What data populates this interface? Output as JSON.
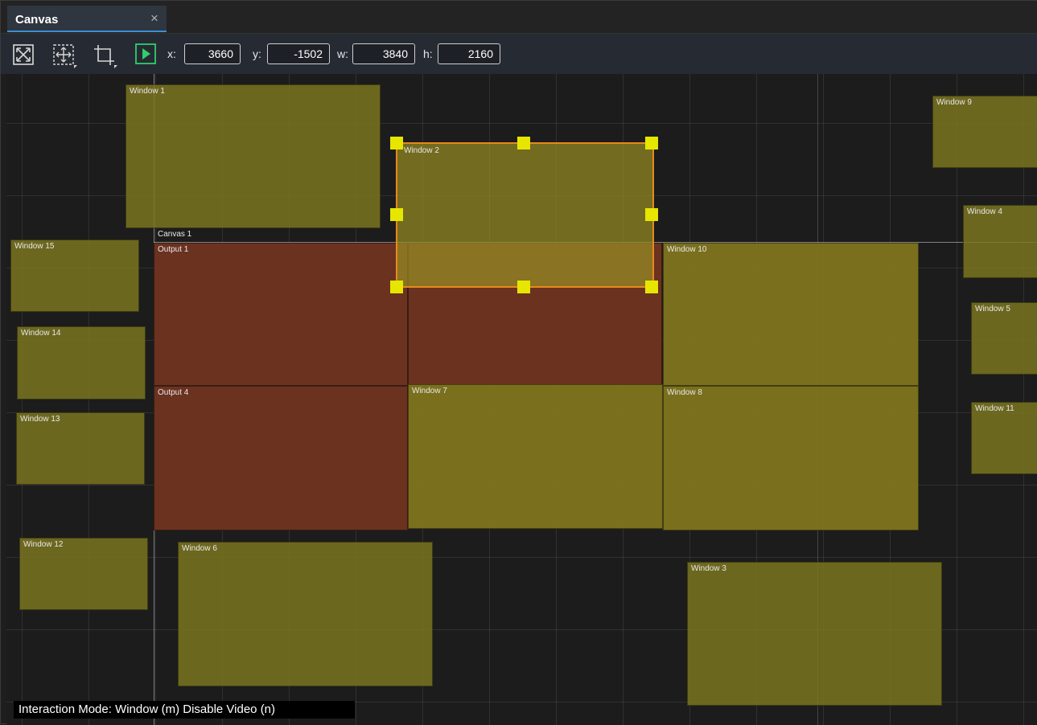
{
  "tab": {
    "title": "Canvas",
    "close_glyph": "×"
  },
  "toolbar": {
    "icons": [
      "fit-screen-icon",
      "move-pan-icon",
      "crop-icon",
      "play-icon"
    ],
    "x_label": "x:",
    "x_value": "3660",
    "y_label": "y:",
    "y_value": "-1502",
    "w_label": "w:",
    "w_value": "3840",
    "h_label": "h:",
    "h_value": "2160",
    "accent_green": "#2fcf6b"
  },
  "canvas": {
    "canvas_label": "Canvas 1",
    "outputs": [
      {
        "label": "Output 1"
      },
      {
        "label": "Output 4"
      }
    ],
    "windows": [
      {
        "label": "Window 1"
      },
      {
        "label": "Window 2"
      },
      {
        "label": "Window 3"
      },
      {
        "label": "Window 4"
      },
      {
        "label": "Window 5"
      },
      {
        "label": "Window 6"
      },
      {
        "label": "Window 7"
      },
      {
        "label": "Window 8"
      },
      {
        "label": "Window 9"
      },
      {
        "label": "Window 10"
      },
      {
        "label": "Window 11"
      },
      {
        "label": "Window 12"
      },
      {
        "label": "Window 13"
      },
      {
        "label": "Window 14"
      },
      {
        "label": "Window 15"
      }
    ],
    "selection_color": "#e88a1a",
    "handle_color": "#e6e600",
    "output_color": "#6b3220",
    "window_color": "#7e7820"
  },
  "status": {
    "text": "Interaction Mode: Window (m) Disable Video (n)"
  }
}
